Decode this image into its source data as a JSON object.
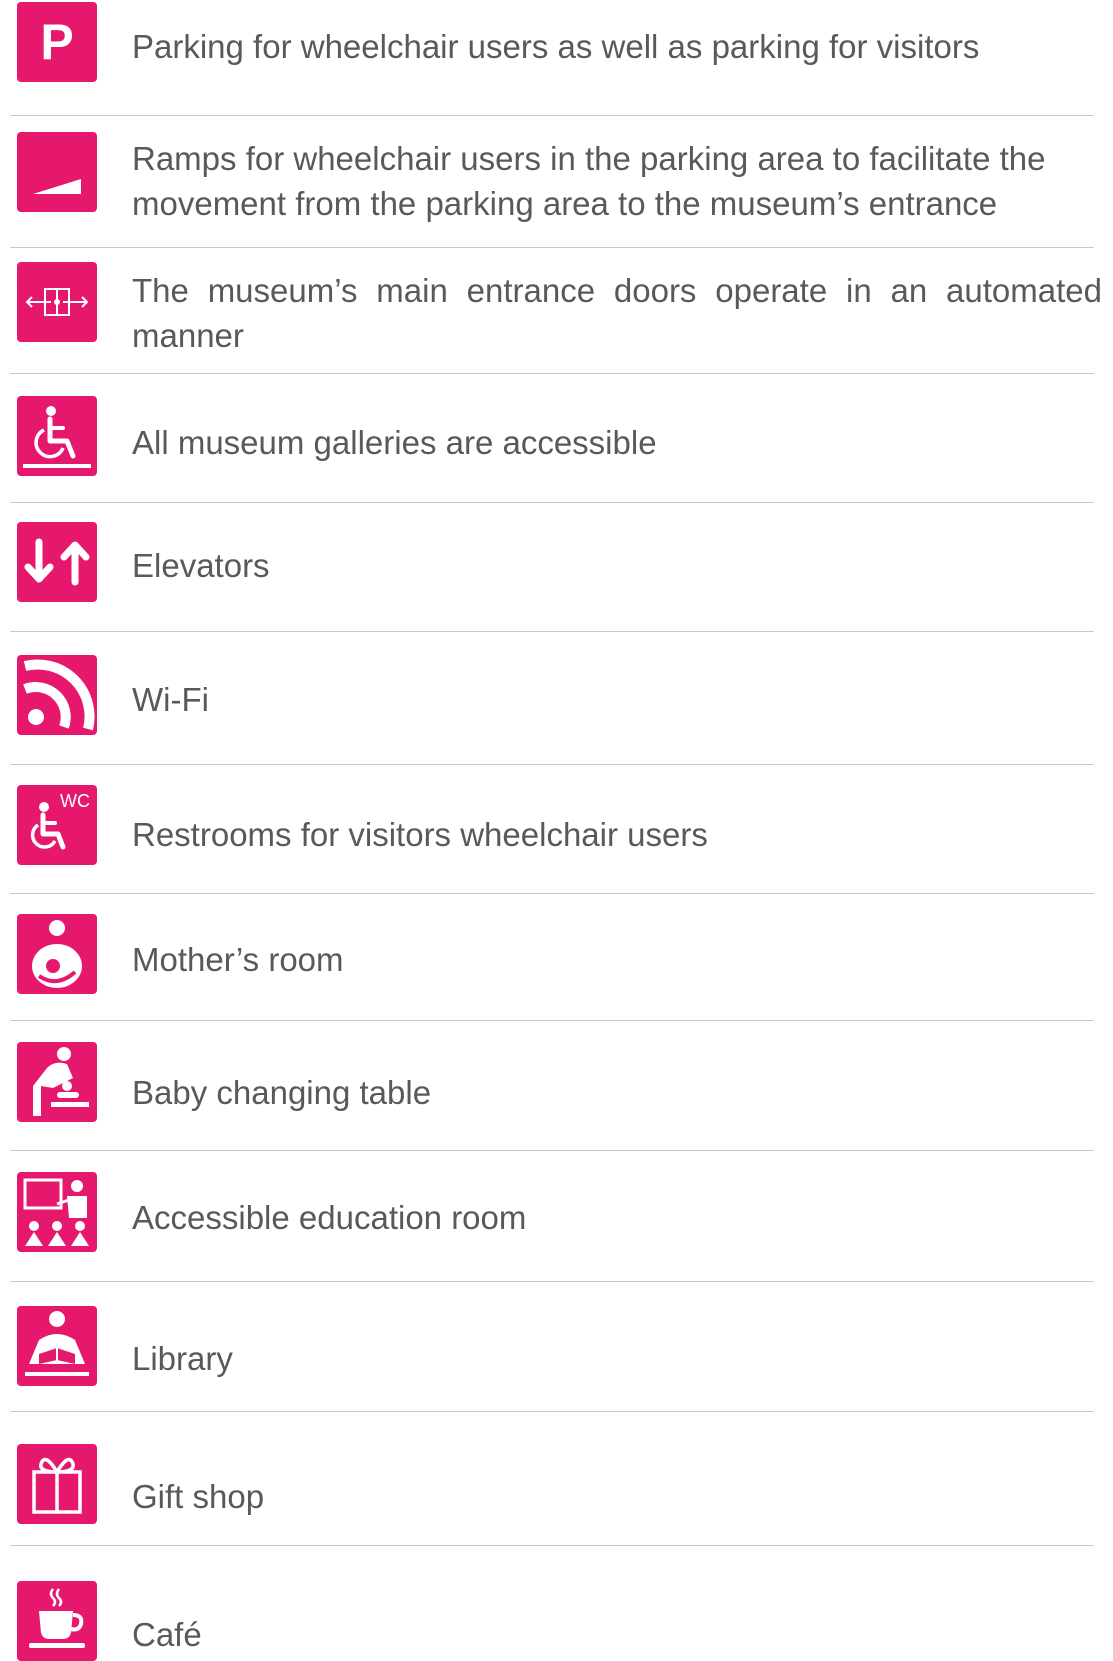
{
  "accent_color": "#e6186e",
  "text_color": "#58595b",
  "divider_color": "#c8c8c8",
  "items": [
    {
      "icon": "parking-icon",
      "glyph": "P",
      "label": "Parking for wheelchair users as well as parking for visitors"
    },
    {
      "icon": "ramp-icon",
      "label": "Ramps for wheelchair users in the parking area to facilitate the movement from the parking area to the museum’s entrance"
    },
    {
      "icon": "automatic-door-icon",
      "label": "The museum’s main entrance doors operate in an automated manner"
    },
    {
      "icon": "wheelchair-accessible-icon",
      "label": "All museum galleries are accessible"
    },
    {
      "icon": "elevator-arrows-icon",
      "label": "Elevators"
    },
    {
      "icon": "wifi-icon",
      "label": "Wi-Fi"
    },
    {
      "icon": "accessible-restroom-icon",
      "glyph": "WC",
      "label": "Restrooms for visitors wheelchair users"
    },
    {
      "icon": "mother-nursing-icon",
      "label": "Mother’s room"
    },
    {
      "icon": "baby-changing-icon",
      "label": "Baby changing table"
    },
    {
      "icon": "education-room-icon",
      "label": "Accessible education room"
    },
    {
      "icon": "library-reader-icon",
      "label": "Library"
    },
    {
      "icon": "gift-box-icon",
      "label": "Gift shop"
    },
    {
      "icon": "coffee-cup-icon",
      "label": "Café"
    }
  ]
}
